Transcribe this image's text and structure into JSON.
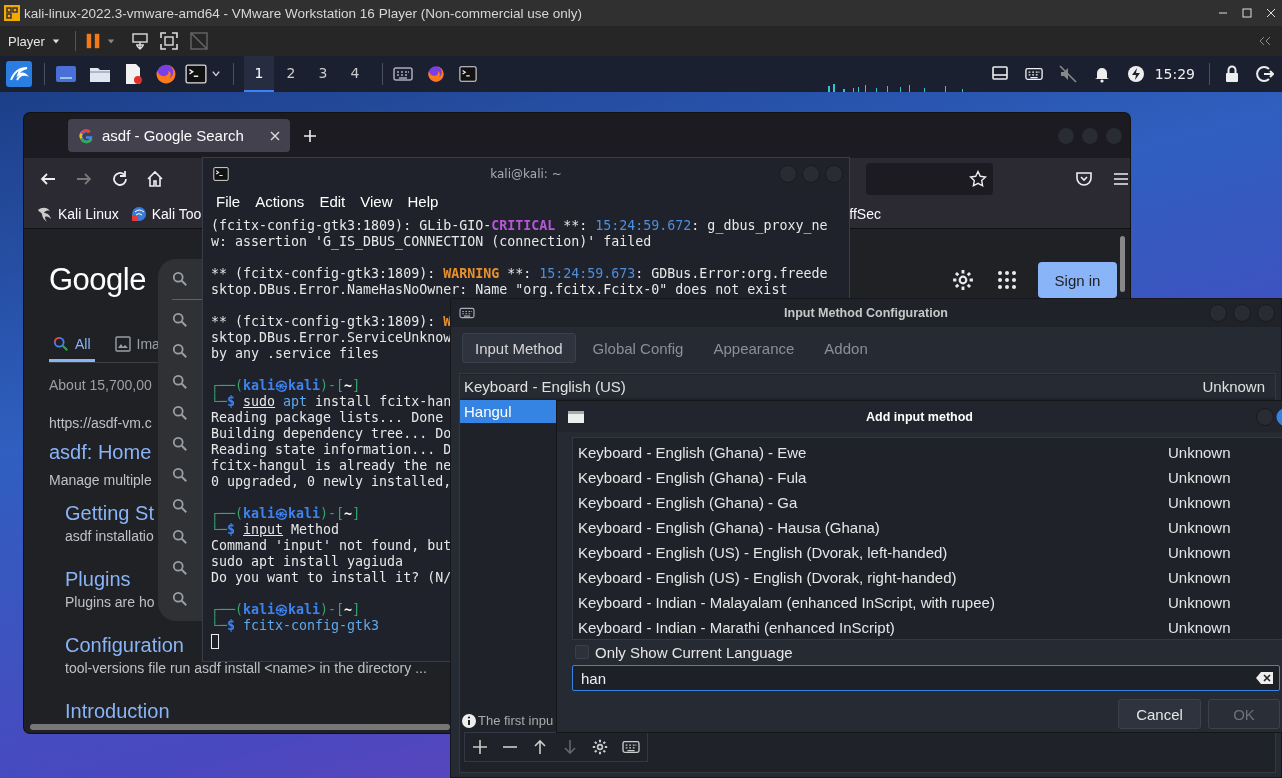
{
  "vm_window": {
    "title": "kali-linux-2022.3-vmware-amd64 - VMware Workstation 16 Player (Non-commercial use only)",
    "menu": "Player"
  },
  "panel": {
    "workspaces": [
      {
        "label": "1",
        "selected": true
      },
      {
        "label": "2",
        "selected": false
      },
      {
        "label": "3",
        "selected": false
      },
      {
        "label": "4",
        "selected": false
      }
    ],
    "clock": "15:29"
  },
  "browser": {
    "tabs": [
      {
        "title": "asdf - Google Search",
        "selected": true
      }
    ],
    "bookmarks": [
      "Kali Linux",
      "Kali Too",
      "ffSec"
    ],
    "logo": "Google",
    "search_tabs": [
      {
        "label": "All",
        "selected": true
      },
      {
        "label": "Ima",
        "selected": false
      }
    ],
    "result_stats": "About 15,700,00",
    "result": {
      "url": "https://asdf-vm.c",
      "title": "asdf: Home",
      "snippet": "Manage multiple"
    },
    "sitelinks": [
      {
        "title": "Getting St",
        "snippet": "asdf installatio"
      },
      {
        "title": "Plugins",
        "snippet": "Plugins are ho"
      },
      {
        "title": "Configuration",
        "snippet": "tool-versions file run asdf install <name> in the directory ..."
      },
      {
        "title": "Introduction"
      }
    ],
    "sign_in": "Sign in"
  },
  "terminal": {
    "title": "kali@kali: ~",
    "menu": [
      "File",
      "Actions",
      "Edit",
      "View",
      "Help"
    ],
    "blocks": [
      {
        "lines": [
          {
            "segments": [
              {
                "text": "(fcitx-config-gtk3:1809): GLib-GIO-"
              },
              {
                "text": "CRITICAL",
                "kind": "critical"
              },
              {
                "text": " **: "
              },
              {
                "text": "15:24:59.672",
                "kind": "time"
              },
              {
                "text": ": g_dbus_proxy_ne"
              }
            ]
          },
          {
            "segments": [
              {
                "text": "w: assertion 'G_IS_DBUS_CONNECTION (connection)' failed"
              }
            ]
          }
        ]
      },
      {
        "lines": [
          {
            "segments": [
              {
                "text": "** (fcitx-config-gtk3:1809): "
              },
              {
                "text": "WARNING",
                "kind": "warning"
              },
              {
                "text": " **: "
              },
              {
                "text": "15:24:59.673",
                "kind": "time"
              },
              {
                "text": ": GDBus.Error:org.freede"
              }
            ]
          },
          {
            "segments": [
              {
                "text": "sktop.DBus.Error.NameHasNoOwner: Name \"org.fcitx.Fcitx-0\" does not exist"
              }
            ]
          }
        ]
      },
      {
        "lines": [
          {
            "segments": [
              {
                "text": "** (fcitx-config-gtk3:1809): "
              },
              {
                "text": "W",
                "kind": "warning"
              }
            ]
          },
          {
            "segments": [
              {
                "text": "sktop.DBus.Error.ServiceUnknow"
              }
            ]
          },
          {
            "segments": [
              {
                "text": "by any .service files"
              }
            ]
          }
        ]
      },
      {
        "lines": [
          {
            "segments": [
              {
                "text": "┌──(",
                "kind": "frame"
              },
              {
                "text": "kali㉿kali",
                "kind": "user"
              },
              {
                "text": ")-[",
                "kind": "frame"
              },
              {
                "text": "~",
                "kind": "path"
              },
              {
                "text": "]",
                "kind": "frame"
              }
            ]
          },
          {
            "segments": [
              {
                "text": "└─",
                "kind": "frame"
              },
              {
                "text": "$ ",
                "kind": "user"
              },
              {
                "text": "sudo",
                "kind": "underline"
              },
              {
                "text": " apt",
                "kind": "command"
              },
              {
                "text": " install fcitx-han"
              }
            ]
          },
          {
            "segments": [
              {
                "text": "Reading package lists... Done"
              }
            ]
          },
          {
            "segments": [
              {
                "text": "Building dependency tree... Do"
              }
            ]
          },
          {
            "segments": [
              {
                "text": "Reading state information... D"
              }
            ]
          },
          {
            "segments": [
              {
                "text": "fcitx-hangul is already the ne"
              }
            ]
          },
          {
            "segments": [
              {
                "text": "0 upgraded, 0 newly installed,"
              }
            ]
          }
        ]
      },
      {
        "lines": [
          {
            "segments": [
              {
                "text": "┌──(",
                "kind": "frame"
              },
              {
                "text": "kali㉿kali",
                "kind": "user"
              },
              {
                "text": ")-[",
                "kind": "frame"
              },
              {
                "text": "~",
                "kind": "path"
              },
              {
                "text": "]",
                "kind": "frame"
              }
            ]
          },
          {
            "segments": [
              {
                "text": "└─",
                "kind": "frame"
              },
              {
                "text": "$ ",
                "kind": "user"
              },
              {
                "text": "input",
                "kind": "underline"
              },
              {
                "text": " Method"
              }
            ]
          },
          {
            "segments": [
              {
                "text": "Command 'input' not found, but"
              }
            ]
          },
          {
            "segments": [
              {
                "text": "sudo apt install yagiuda"
              }
            ]
          },
          {
            "segments": [
              {
                "text": "Do you want to install it? (N/"
              }
            ]
          }
        ]
      },
      {
        "lines": [
          {
            "segments": [
              {
                "text": "┌──(",
                "kind": "frame"
              },
              {
                "text": "kali㉿kali",
                "kind": "user"
              },
              {
                "text": ")-[",
                "kind": "frame"
              },
              {
                "text": "~",
                "kind": "path"
              },
              {
                "text": "]",
                "kind": "frame"
              }
            ]
          },
          {
            "segments": [
              {
                "text": "└─",
                "kind": "frame"
              },
              {
                "text": "$ ",
                "kind": "user"
              },
              {
                "text": "fcitx-config-gtk3",
                "kind": "command"
              }
            ]
          }
        ]
      }
    ]
  },
  "im_config": {
    "title": "Input Method Configuration",
    "tabs": [
      {
        "label": "Input Method",
        "selected": true
      },
      {
        "label": "Global Config",
        "selected": false
      },
      {
        "label": "Appearance",
        "selected": false
      },
      {
        "label": "Addon",
        "selected": false
      }
    ],
    "methods": [
      {
        "name": "Keyboard - English (US)",
        "layout": "Unknown",
        "selected": false
      },
      {
        "name": "Hangul",
        "selected": true
      }
    ],
    "info": "The first inpu"
  },
  "add_dialog": {
    "title": "Add input method",
    "methods": [
      {
        "name": "Keyboard - English (Ghana) - Ewe",
        "layout": "Unknown"
      },
      {
        "name": "Keyboard - English (Ghana) - Fula",
        "layout": "Unknown"
      },
      {
        "name": "Keyboard - English (Ghana) - Ga",
        "layout": "Unknown"
      },
      {
        "name": "Keyboard - English (Ghana) - Hausa (Ghana)",
        "layout": "Unknown"
      },
      {
        "name": "Keyboard - English (US) - English (Dvorak, left-handed)",
        "layout": "Unknown"
      },
      {
        "name": "Keyboard - English (US) - English (Dvorak, right-handed)",
        "layout": "Unknown"
      },
      {
        "name": "Keyboard - Indian - Malayalam (enhanced InScript, with rupee)",
        "layout": "Unknown"
      },
      {
        "name": "Keyboard - Indian - Marathi (enhanced InScript)",
        "layout": "Unknown"
      }
    ],
    "only_current_language": {
      "label": "Only Show Current Language",
      "checked": false
    },
    "search": {
      "value": "han"
    },
    "buttons": [
      {
        "label": "Cancel",
        "disabled": false
      },
      {
        "label": "OK",
        "disabled": true
      }
    ]
  }
}
